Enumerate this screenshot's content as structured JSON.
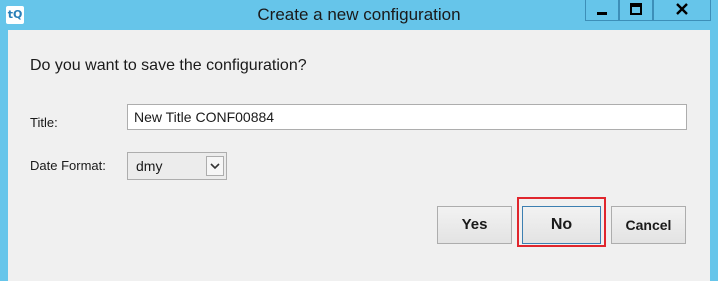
{
  "window": {
    "app_icon_text": "tQ",
    "title": "Create a new configuration",
    "controls": {
      "minimize_icon": "minimize-icon",
      "maximize_icon": "maximize-icon",
      "close_icon": "close-icon"
    }
  },
  "dialog": {
    "question": "Do you want to save the configuration?",
    "title_label": "Title:",
    "title_value": "New Title CONF00884",
    "date_format_label": "Date Format:",
    "date_format_value": "dmy",
    "buttons": {
      "yes": "Yes",
      "no": "No",
      "cancel": "Cancel"
    }
  },
  "colors": {
    "window_frame": "#66c5ea",
    "client_bg": "#f0f0f0",
    "highlight": "#e0262d"
  }
}
